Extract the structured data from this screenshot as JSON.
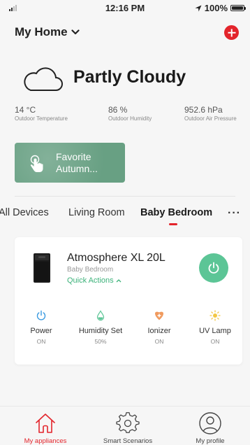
{
  "status_bar": {
    "time": "12:16 PM",
    "battery": "100%"
  },
  "header": {
    "title": "My Home"
  },
  "weather": {
    "condition": "Partly Cloudy",
    "temperature": {
      "value": "14 °C",
      "label": "Outdoor Temperature"
    },
    "humidity": {
      "value": "86 %",
      "label": "Outdoor Humidity"
    },
    "pressure": {
      "value": "952.6 hPa",
      "label": "Outdoor Air Pressure"
    }
  },
  "favorite": {
    "line1": "Favorite",
    "line2": "Autumn..."
  },
  "tabs": [
    {
      "label": "All Devices"
    },
    {
      "label": "Living Room"
    },
    {
      "label": "Baby Bedroom"
    }
  ],
  "active_tab": "Baby Bedroom",
  "more_label": "···",
  "device": {
    "name": "Atmosphere XL 20L",
    "room": "Baby Bedroom",
    "quick_actions": "Quick Actions",
    "controls": [
      {
        "name": "Power",
        "state": "ON",
        "icon": "power-icon",
        "color": "#3a9ae0"
      },
      {
        "name": "Humidity Set",
        "state": "50%",
        "icon": "water-drop-icon",
        "color": "#5cc596"
      },
      {
        "name": "Ionizer",
        "state": "ON",
        "icon": "ionizer-icon",
        "color": "#f09a5e"
      },
      {
        "name": "UV Lamp",
        "state": "ON",
        "icon": "sun-icon",
        "color": "#f2c744"
      }
    ]
  },
  "bottom_nav": [
    {
      "label": "My appliances",
      "icon": "home-icon"
    },
    {
      "label": "Smart Scenarios",
      "icon": "gear-icon"
    },
    {
      "label": "My profile",
      "icon": "user-icon"
    }
  ],
  "colors": {
    "accent_red": "#e3242b",
    "accent_green": "#5cc596",
    "favorite_card": "#68a083"
  }
}
